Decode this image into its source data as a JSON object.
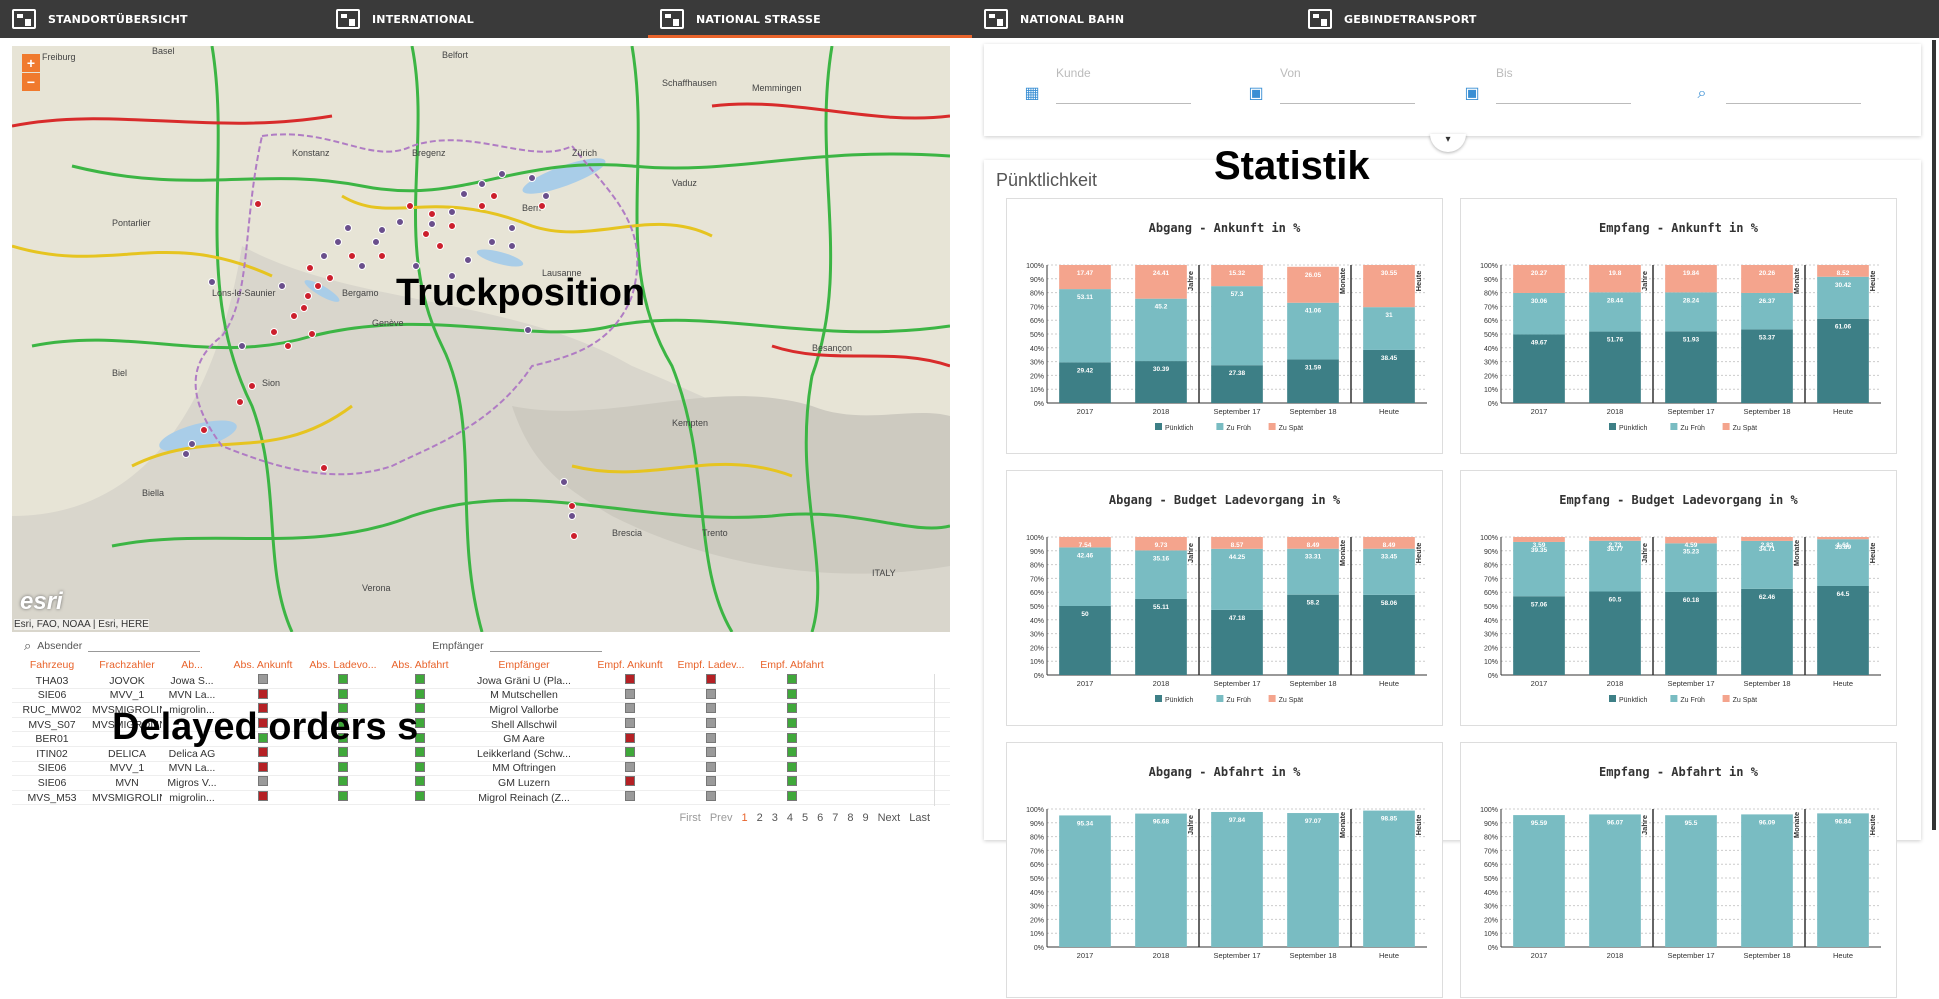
{
  "nav": {
    "tabs": [
      {
        "label": "STANDORTÜBERSICHT",
        "active": false
      },
      {
        "label": "INTERNATIONAL",
        "active": false
      },
      {
        "label": "NATIONAL STRASSE",
        "active": true
      },
      {
        "label": "NATIONAL BAHN",
        "active": false
      },
      {
        "label": "GEBINDETRANSPORT",
        "active": false
      }
    ]
  },
  "map": {
    "overlay_label": "Truckposition",
    "logo": "esri",
    "attribution": "Esri, FAO, NOAA | Esri, HERE",
    "place_labels": [
      "Freiburg",
      "Basel",
      "Belfort",
      "Schaffhausen",
      "Konstanz",
      "Bregenz",
      "Zürich",
      "Vaduz",
      "Bern",
      "Lausanne",
      "Genève",
      "Sion",
      "Biella",
      "Verona",
      "ITALY",
      "Besançon",
      "Pontarlier",
      "Lons-le-Saunier",
      "Biel",
      "Bergamo",
      "Brescia",
      "Trento",
      "Kempten",
      "Memmingen"
    ],
    "colors": {
      "red": "#cc1f2d",
      "purple": "#6a4f8c"
    }
  },
  "filters": {
    "absender_label": "Absender",
    "empfaenger_label": "Empfänger"
  },
  "table": {
    "overlay_label": "Delayed orders s",
    "columns": [
      "Fahrzeug",
      "Frachzahler",
      "Ab...",
      "Abs. Ankunft",
      "Abs. Ladevo...",
      "Abs. Abfahrt",
      "Empfänger",
      "Empf. Ankunft",
      "Empf. Ladev...",
      "Empf. Abfahrt"
    ],
    "rows": [
      {
        "fahrzeug": "THA03",
        "frachzahler": "JOVOK",
        "ab": "Jowa S...",
        "s": [
          "gray",
          "green",
          "green"
        ],
        "empf": "Jowa Gräni U (Pla...",
        "e": [
          "red",
          "red",
          "green"
        ]
      },
      {
        "fahrzeug": "SIE06",
        "frachzahler": "MVV_1",
        "ab": "MVN La...",
        "s": [
          "red",
          "green",
          "green"
        ],
        "empf": "M Mutschellen",
        "e": [
          "gray",
          "gray",
          "green"
        ]
      },
      {
        "fahrzeug": "RUC_MW02",
        "frachzahler": "MVSMIGROLINO",
        "ab": "migrolin...",
        "s": [
          "red",
          "green",
          "green"
        ],
        "empf": "Migrol Vallorbe",
        "e": [
          "gray",
          "gray",
          "green"
        ]
      },
      {
        "fahrzeug": "MVS_S07",
        "frachzahler": "MVSMIGROLINO",
        "ab": "",
        "s": [
          "red",
          "green",
          "green"
        ],
        "empf": "Shell Allschwil",
        "e": [
          "gray",
          "gray",
          "green"
        ]
      },
      {
        "fahrzeug": "BER01",
        "frachzahler": "",
        "ab": "",
        "s": [
          "green",
          "green",
          "green"
        ],
        "empf": "GM Aare",
        "e": [
          "red",
          "gray",
          "green"
        ]
      },
      {
        "fahrzeug": "ITIN02",
        "frachzahler": "DELICA",
        "ab": "Delica AG",
        "s": [
          "red",
          "green",
          "green"
        ],
        "empf": "Leikkerland (Schw...",
        "e": [
          "green",
          "gray",
          "green"
        ]
      },
      {
        "fahrzeug": "SIE06",
        "frachzahler": "MVV_1",
        "ab": "MVN La...",
        "s": [
          "red",
          "green",
          "green"
        ],
        "empf": "MM Oftringen",
        "e": [
          "gray",
          "gray",
          "green"
        ]
      },
      {
        "fahrzeug": "SIE06",
        "frachzahler": "MVN",
        "ab": "Migros V...",
        "s": [
          "gray",
          "green",
          "green"
        ],
        "empf": "GM Luzern",
        "e": [
          "red",
          "gray",
          "green"
        ]
      },
      {
        "fahrzeug": "MVS_M53",
        "frachzahler": "MVSMIGROLINO",
        "ab": "migrolin...",
        "s": [
          "red",
          "green",
          "green"
        ],
        "empf": "Migrol Reinach (Z...",
        "e": [
          "gray",
          "gray",
          "green"
        ]
      }
    ],
    "pager": {
      "first": "First",
      "prev": "Prev",
      "pages": [
        "1",
        "2",
        "3",
        "4",
        "5",
        "6",
        "7",
        "8",
        "9"
      ],
      "current": "1",
      "next": "Next",
      "last": "Last"
    }
  },
  "search": {
    "kunde": "Kunde",
    "von": "Von",
    "bis": "Bis"
  },
  "stats": {
    "overlay_label": "Statistik",
    "section_title": "Pünktlichkeit",
    "colors": {
      "puenktlich": "#3d7f86",
      "zu_frueh": "#79bcc2",
      "zu_spaet": "#f4a48d"
    },
    "legend": [
      "Pünktlich",
      "Zu Früh",
      "Zu Spät"
    ]
  },
  "chart_data": [
    {
      "type": "bar",
      "title": "Abgang - Ankunft in %",
      "categories": [
        "2017",
        "2018",
        "September 17",
        "September 18",
        "Heute"
      ],
      "group_labels": [
        "Jahre",
        "Monate",
        "Heute"
      ],
      "ylim": [
        0,
        100
      ],
      "series": [
        {
          "name": "Pünktlich",
          "values": [
            29.42,
            30.39,
            27.38,
            31.59,
            38.45
          ]
        },
        {
          "name": "Zu Früh",
          "values": [
            53.11,
            45.2,
            57.3,
            41.06,
            31
          ]
        },
        {
          "name": "Zu Spät",
          "values": [
            17.47,
            24.41,
            15.32,
            26.05,
            30.55
          ]
        }
      ]
    },
    {
      "type": "bar",
      "title": "Empfang - Ankunft in %",
      "categories": [
        "2017",
        "2018",
        "September 17",
        "September 18",
        "Heute"
      ],
      "group_labels": [
        "Jahre",
        "Monate",
        "Heute"
      ],
      "ylim": [
        0,
        100
      ],
      "series": [
        {
          "name": "Pünktlich",
          "values": [
            49.67,
            51.76,
            51.93,
            53.37,
            61.06
          ]
        },
        {
          "name": "Zu Früh",
          "values": [
            30.06,
            28.44,
            28.24,
            26.37,
            30.42
          ]
        },
        {
          "name": "Zu Spät",
          "values": [
            20.27,
            19.8,
            19.84,
            20.26,
            8.52
          ]
        }
      ]
    },
    {
      "type": "bar",
      "title": "Abgang - Budget Ladevorgang in %",
      "categories": [
        "2017",
        "2018",
        "September 17",
        "September 18",
        "Heute"
      ],
      "group_labels": [
        "Jahre",
        "Monate",
        "Heute"
      ],
      "ylim": [
        0,
        100
      ],
      "series": [
        {
          "name": "Pünktlich",
          "values": [
            50,
            55.11,
            47.18,
            58.2,
            58.06
          ]
        },
        {
          "name": "Zu Früh",
          "values": [
            42.46,
            35.16,
            44.25,
            33.31,
            33.45
          ]
        },
        {
          "name": "Zu Spät",
          "values": [
            7.54,
            9.73,
            8.57,
            8.49,
            8.49
          ]
        }
      ]
    },
    {
      "type": "bar",
      "title": "Empfang - Budget Ladevorgang in %",
      "categories": [
        "2017",
        "2018",
        "September 17",
        "September 18",
        "Heute"
      ],
      "group_labels": [
        "Jahre",
        "Monate",
        "Heute"
      ],
      "ylim": [
        0,
        100
      ],
      "series": [
        {
          "name": "Pünktlich",
          "values": [
            57.06,
            60.5,
            60.18,
            62.46,
            64.5
          ]
        },
        {
          "name": "Zu Früh",
          "values": [
            39.35,
            36.77,
            35.23,
            34.71,
            33.89
          ]
        },
        {
          "name": "Zu Spät",
          "values": [
            3.59,
            2.73,
            4.59,
            2.83,
            1.61
          ]
        }
      ]
    },
    {
      "type": "bar",
      "title": "Abgang - Abfahrt in %",
      "categories": [
        "2017",
        "2018",
        "September 17",
        "September 18",
        "Heute"
      ],
      "group_labels": [
        "Jahre",
        "Monate",
        "Heute"
      ],
      "ylim": [
        0,
        100
      ],
      "series": [
        {
          "name": "Zu Früh",
          "values": [
            95.34,
            96.68,
            97.84,
            97.07,
            98.85
          ]
        }
      ]
    },
    {
      "type": "bar",
      "title": "Empfang - Abfahrt in %",
      "categories": [
        "2017",
        "2018",
        "September 17",
        "September 18",
        "Heute"
      ],
      "group_labels": [
        "Jahre",
        "Monate",
        "Heute"
      ],
      "ylim": [
        0,
        100
      ],
      "series": [
        {
          "name": "Zu Früh",
          "values": [
            95.59,
            96.07,
            95.5,
            96.09,
            96.84
          ]
        }
      ]
    }
  ]
}
